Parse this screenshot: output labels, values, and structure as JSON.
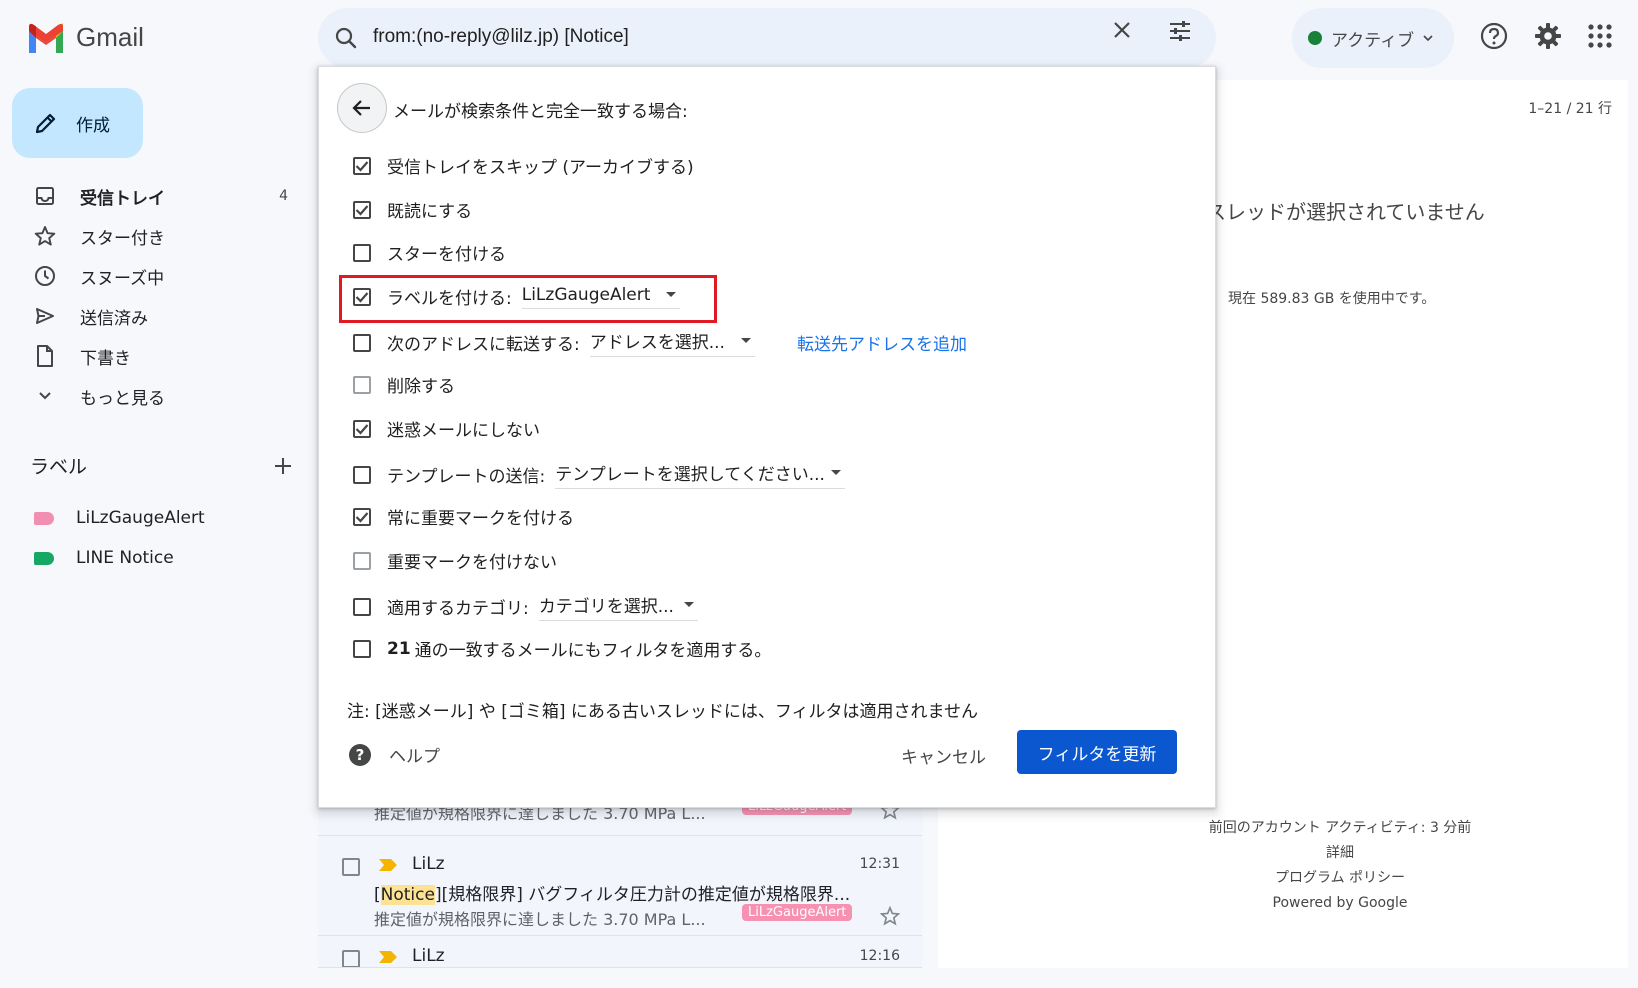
{
  "app": {
    "name": "Gmail"
  },
  "search": {
    "query": "from:(no-reply@lilz.jp) [Notice]"
  },
  "status": {
    "label": "アクティブ",
    "dot_color": "#188038"
  },
  "sidebar": {
    "compose_label": "作成",
    "items": [
      {
        "label": "受信トレイ",
        "count": "4",
        "icon": "inbox-icon"
      },
      {
        "label": "スター付き",
        "icon": "star-icon"
      },
      {
        "label": "スヌーズ中",
        "icon": "clock-icon"
      },
      {
        "label": "送信済み",
        "icon": "send-icon"
      },
      {
        "label": "下書き",
        "icon": "draft-icon"
      },
      {
        "label": "もっと見る",
        "icon": "chevron-down-icon"
      }
    ],
    "labels_heading": "ラベル",
    "labels": [
      {
        "label": "LiLzGaugeAlert",
        "color": "#f28fb0"
      },
      {
        "label": "LINE Notice",
        "color": "#16a765"
      }
    ]
  },
  "filter_dialog": {
    "title": "メールが検索条件と完全一致する場合:",
    "options": [
      {
        "label": "受信トレイをスキップ (アーカイブする)",
        "checked": true
      },
      {
        "label": "既読にする",
        "checked": true
      },
      {
        "label": "スターを付ける",
        "checked": false
      },
      {
        "label": "ラベルを付ける:",
        "checked": true,
        "dropdown": "LiLzGaugeAlert"
      },
      {
        "label": "次のアドレスに転送する:",
        "checked": false,
        "dropdown": "アドレスを選択...",
        "link": "転送先アドレスを追加"
      },
      {
        "label": "削除する",
        "checked": false
      },
      {
        "label": "迷惑メールにしない",
        "checked": true
      },
      {
        "label": "テンプレートの送信:",
        "checked": false,
        "dropdown": "テンプレートを選択してください..."
      },
      {
        "label": "常に重要マークを付ける",
        "checked": true
      },
      {
        "label": "重要マークを付けない",
        "checked": false
      },
      {
        "label": "適用するカテゴリ:",
        "checked": false,
        "dropdown": "カテゴリを選択..."
      },
      {
        "label_bold": "21",
        "label": "通の一致するメールにもフィルタを適用する。",
        "checked": false
      }
    ],
    "note": "注: [迷惑メール] や [ゴミ箱] にある古いスレッドには、フィルタは適用されません",
    "help_label": "ヘルプ",
    "cancel_label": "キャンセル",
    "update_label": "フィルタを更新",
    "highlight_color": "#e01a23"
  },
  "emails": [
    {
      "sender": "",
      "time": "",
      "subject": "",
      "snippet": "推定値が規格限界に達しました 3.70 MPa L...",
      "label": "LiLzGaugeAlert"
    },
    {
      "sender": "LiLz",
      "time": "12:31",
      "subject_pre": "[",
      "subject_hl": "Notice",
      "subject_post": "][規格限界] バグフィルタ圧力計の推定値が規格限界...",
      "snippet": "推定値が規格限界に達しました 3.70 MPa L...",
      "label": "LiLzGaugeAlert"
    },
    {
      "sender": "LiLz",
      "time": "12:16"
    }
  ],
  "right_pane": {
    "pagination": "1–21 / 21 行",
    "no_thread": "スレッドが選択されていません",
    "storage": "現在 589.83 GB を使用中です。",
    "last_activity": "前回のアカウント アクティビティ: 3 分前",
    "details": "詳細",
    "program_policy": "プログラム ポリシー",
    "powered_by": "Powered by Google"
  }
}
